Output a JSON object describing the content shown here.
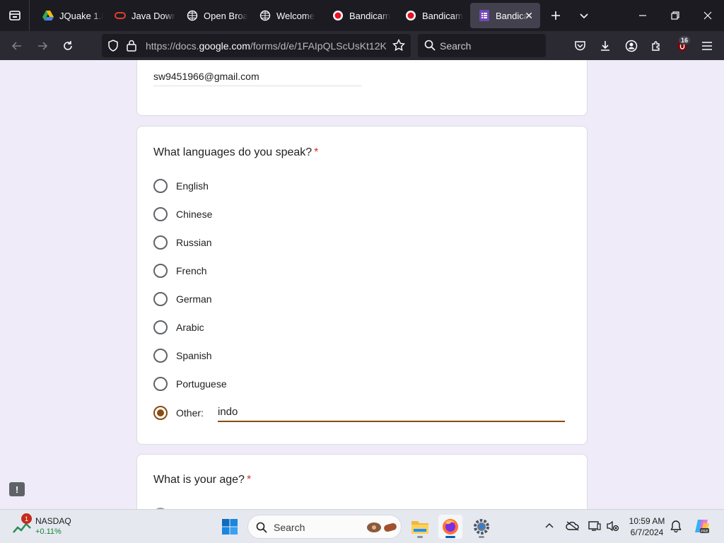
{
  "browser": {
    "tabs": [
      {
        "title": "JQuake 1.8",
        "icon": "google-drive-icon",
        "active": false
      },
      {
        "title": "Java Down",
        "icon": "oracle-icon",
        "active": false
      },
      {
        "title": "Open Broa",
        "icon": "globe-icon",
        "active": false
      },
      {
        "title": "Welcome",
        "icon": "globe-icon",
        "active": false
      },
      {
        "title": "Bandicam",
        "icon": "bandicam-icon",
        "active": false
      },
      {
        "title": "Bandicam",
        "icon": "bandicam-icon",
        "active": false
      },
      {
        "title": "Bandica",
        "icon": "google-forms-icon",
        "active": true
      }
    ],
    "url_prefix": "https://docs.",
    "url_domain": "google.com",
    "url_suffix": "/forms/d/e/1FAIpQLScUsKt12K",
    "search_placeholder": "Search",
    "extension_badge": "16",
    "accent": "#42414d"
  },
  "form": {
    "email_value": "sw9451966@gmail.com",
    "question1": {
      "title": "What languages do you speak?",
      "required_mark": "*",
      "options": [
        "English",
        "Chinese",
        "Russian",
        "French",
        "German",
        "Arabic",
        "Spanish",
        "Portuguese"
      ],
      "other_label": "Other:",
      "other_value": "indo",
      "selected": "Other"
    },
    "question2": {
      "title": "What is your age?",
      "required_mark": "*"
    },
    "theme_color": "#8a4b12"
  },
  "taskbar": {
    "widget_name": "NASDAQ",
    "widget_change": "+0.11%",
    "widget_badge": "1",
    "search_placeholder": "Search",
    "time": "10:59 AM",
    "date": "6/7/2024"
  }
}
